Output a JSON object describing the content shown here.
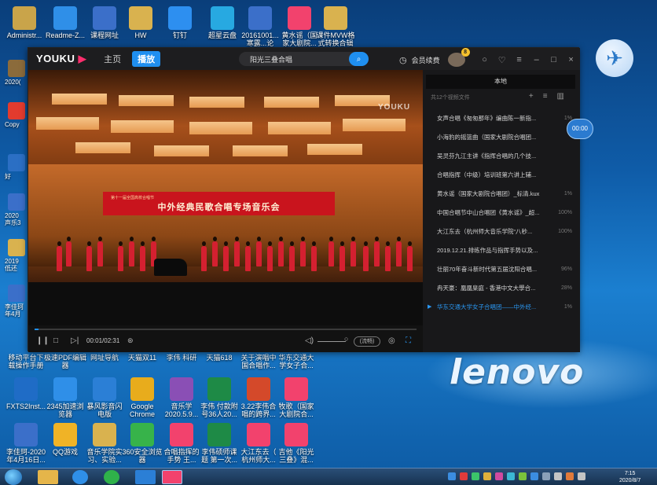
{
  "desktop": {
    "top_icons": [
      {
        "label": "Administr...",
        "icon": "user-folder-icon",
        "color": "#c9a44a"
      },
      {
        "label": "Readme-Z...",
        "icon": "ie-browser-icon",
        "color": "#2f8fe8"
      },
      {
        "label": "课程网址",
        "icon": "word-doc-icon",
        "color": "#3b6fc9"
      },
      {
        "label": "HW",
        "icon": "folder-icon",
        "color": "#d9b24f"
      },
      {
        "label": "钉钉",
        "icon": "dingtalk-icon",
        "color": "#2d8ff0"
      },
      {
        "label": "超星云盘",
        "icon": "cloud-disk-icon",
        "color": "#27a9e1"
      },
      {
        "label": "20161001...\n寒露...论",
        "icon": "word-doc-icon",
        "color": "#3b6fc9"
      },
      {
        "label": "黄水谣（国\n家大剧院...",
        "icon": "youku-video-icon",
        "color": "#f2426d"
      },
      {
        "label": "课件MVW格\n式转换合辑",
        "icon": "folder-icon",
        "color": "#d9b24f"
      }
    ],
    "bottom_icons": [
      {
        "label": "移动平台下\n载操作手册",
        "icon": "pdf-icon",
        "color": "#e33b2e"
      },
      {
        "label": "极速PDF编辑\n器",
        "icon": "pdf-editor-icon",
        "color": "#e33b2e"
      },
      {
        "label": "网址导航",
        "icon": "ie-browser-icon",
        "color": "#2f8fe8"
      },
      {
        "label": "天猫双11",
        "icon": "shop-icon",
        "color": "#d3171c"
      },
      {
        "label": "李伟 科研",
        "icon": "folder-icon",
        "color": "#d9b24f"
      },
      {
        "label": "天猫618",
        "icon": "shop-icon",
        "color": "#d3171c"
      },
      {
        "label": "关于演唱中\n国合唱作...",
        "icon": "word-doc-icon",
        "color": "#3b6fc9"
      },
      {
        "label": "华东交通大\n学女子合...",
        "icon": "youku-video-icon",
        "color": "#f2426d"
      },
      {
        "label": "FXTS2Inst...",
        "icon": "installer-icon",
        "color": "#1f6cc6"
      },
      {
        "label": "2345加速浏\n览器",
        "icon": "ie-browser-icon",
        "color": "#2f8fe8"
      },
      {
        "label": "暴风影音闪\n电版",
        "icon": "storm-player-icon",
        "color": "#2b7fd6"
      },
      {
        "label": "Google\nChrome",
        "icon": "chrome-icon",
        "color": "#e8ac1c"
      },
      {
        "label": "音乐学\n2020.5.9...",
        "icon": "winrar-icon",
        "color": "#8a4fb5"
      },
      {
        "label": "李伟 付款附\n号36人20...",
        "icon": "excel-icon",
        "color": "#1e8a46"
      },
      {
        "label": "3.22李伟合\n唱的跨界...",
        "icon": "ppt-icon",
        "color": "#d4492a"
      },
      {
        "label": "牧歌（国家\n大剧院合...",
        "icon": "youku-video-icon",
        "color": "#f2426d"
      },
      {
        "label": "李佳珂-2020\n年4月16日...",
        "icon": "word-doc-icon",
        "color": "#3b6fc9"
      },
      {
        "label": "QQ游戏",
        "icon": "qq-game-icon",
        "color": "#f0b326"
      },
      {
        "label": "音乐学院实\n习、实验...",
        "icon": "folder-icon",
        "color": "#d9b24f"
      },
      {
        "label": "360安全浏览\n器",
        "icon": "360-browser-icon",
        "color": "#37b34a"
      },
      {
        "label": "合唱指挥的\n手势 王...",
        "icon": "youku-video-icon",
        "color": "#f2426d"
      },
      {
        "label": "李伟硕师课\n题 第一次...",
        "icon": "excel-icon",
        "color": "#1e8a46"
      },
      {
        "label": "大江东去（\n杭州师大...",
        "icon": "youku-video-icon",
        "color": "#f2426d"
      },
      {
        "label": "吉他《阳光\n三叠》混...",
        "icon": "youku-video-icon",
        "color": "#f2426d"
      }
    ],
    "left_strip": [
      {
        "label": "2020(",
        "color": "#8b6b3b"
      },
      {
        "label": "Copy",
        "color": "#e33b2e"
      },
      {
        "label": "好",
        "color": "#2b6fc4"
      },
      {
        "label": "2020\n声乐3",
        "color": "#3b6fc9"
      },
      {
        "label": "2019\n低还",
        "color": "#d9b24f"
      },
      {
        "label": "李佳珂\n年4月",
        "color": "#3b6fc9"
      }
    ],
    "brand": "lenovo"
  },
  "player": {
    "logo": "YOUKU",
    "tabs": [
      "主页",
      "播放"
    ],
    "search_text": "阳光三叠合唱",
    "vip_label": "会员续费",
    "badge": "8",
    "video": {
      "watermark": "YOUKU",
      "banner_small": "第十一届全国高校合唱节",
      "banner_big": "中外经典民歌合唱专场音乐会"
    },
    "controls": {
      "time": "00:01/02:31",
      "quality": "(流畅)",
      "progress": 0.01
    },
    "playlist": {
      "title": "本地",
      "count_label": "共12个视频文件",
      "items": [
        {
          "title": "女声合唱《匆匆那年》编曲陈一新指...",
          "pct": "1%",
          "active": false
        },
        {
          "title": "小海豹的摇篮曲（国家大剧院合唱团...",
          "pct": "",
          "active": false
        },
        {
          "title": "吴灵芬九江主讲《指挥合唱的几个技...",
          "pct": "",
          "active": false
        },
        {
          "title": "合唱指挥（中级）培训班第六讲上辅...",
          "pct": "",
          "active": false
        },
        {
          "title": "黄水谣（国家大剧院合唱团）_标清.kux",
          "pct": "1%",
          "active": false
        },
        {
          "title": "中国合唱节中山合唱团《黄水谣》_超...",
          "pct": "100%",
          "active": false
        },
        {
          "title": "大江东去（杭州师大音乐学院“八秒...",
          "pct": "100%",
          "active": false
        },
        {
          "title": "2019.12.21.排练作品与指挥手势以及...",
          "pct": "",
          "active": false
        },
        {
          "title": "壮丽70年奋斗新时代第五届沈阳合唱...",
          "pct": "96%",
          "active": false
        },
        {
          "title": "冉天豪：凰凰臬庭 - 香港中文大學合...",
          "pct": "28%",
          "active": false
        },
        {
          "title": "华东交通大学女子合唱团——中外经...",
          "pct": "1%",
          "active": true
        }
      ]
    },
    "timer_bubble": "00:00"
  },
  "taskbar": {
    "clock_time": "7:15",
    "clock_date": "2020/8/7"
  }
}
